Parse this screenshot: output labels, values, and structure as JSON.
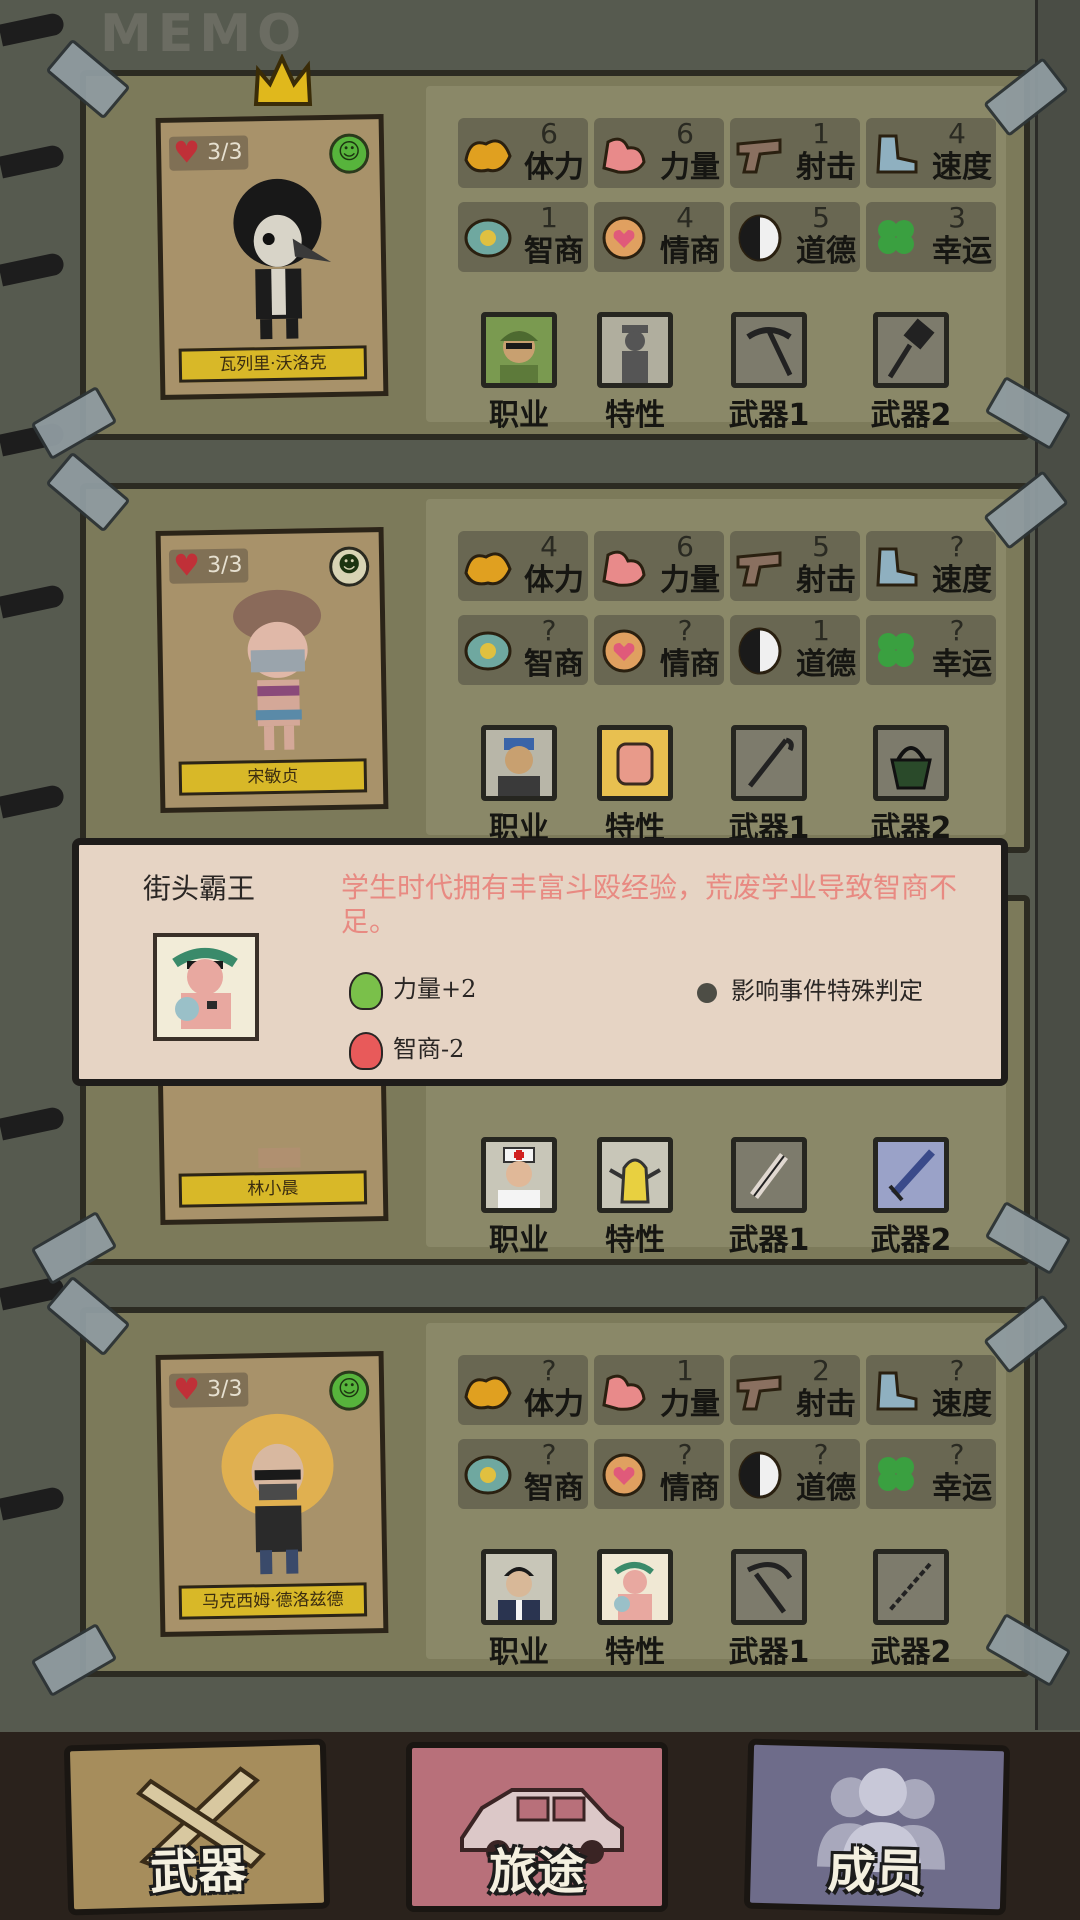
{
  "header": {
    "title": "MEMO"
  },
  "slot_labels": {
    "job": "职业",
    "trait": "特性",
    "weapon1": "武器1",
    "weapon2": "武器2"
  },
  "stat_labels": [
    "体力",
    "力量",
    "射击",
    "速度",
    "智商",
    "情商",
    "道德",
    "幸运"
  ],
  "stat_icons": [
    "muscle-icon",
    "arm-icon",
    "pistol-icon",
    "boot-icon",
    "brain-icon",
    "heart-icon",
    "mask-icon",
    "clover-icon"
  ],
  "members": [
    {
      "name": "瓦列里·沃洛克",
      "hp": "3/3",
      "mood": "smile",
      "leader": true,
      "stats": [
        "6",
        "6",
        "1",
        "4",
        "1",
        "4",
        "5",
        "3"
      ]
    },
    {
      "name": "宋敏贞",
      "hp": "3/3",
      "mood": "grin",
      "leader": false,
      "stats": [
        "4",
        "6",
        "5",
        "?",
        "?",
        "?",
        "1",
        "?"
      ]
    },
    {
      "name": "林小晨",
      "hp": "",
      "mood": "",
      "leader": false,
      "stats": []
    },
    {
      "name": "马克西姆·德洛兹德",
      "hp": "3/3",
      "mood": "smile",
      "leader": false,
      "stats": [
        "?",
        "1",
        "2",
        "?",
        "?",
        "?",
        "?",
        "?"
      ]
    }
  ],
  "popup": {
    "title": "街头霸王",
    "description": "学生时代拥有丰富斗殴经验，荒废学业导致智商不足。",
    "bonus": "力量+2",
    "penalty": "智商-2",
    "note": "影响事件特殊判定"
  },
  "bottom_nav": [
    {
      "label": "武器",
      "color": "#a68d5c"
    },
    {
      "label": "旅途",
      "color": "#b8707a"
    },
    {
      "label": "成员",
      "color": "#6e6c8a"
    }
  ],
  "colors": {
    "panel": "#7c7a5a",
    "name_bar": "#d8b828",
    "popup_bg": "#e6d4c4",
    "popup_text": "#e88a82",
    "mood_green": "#57b43c"
  }
}
